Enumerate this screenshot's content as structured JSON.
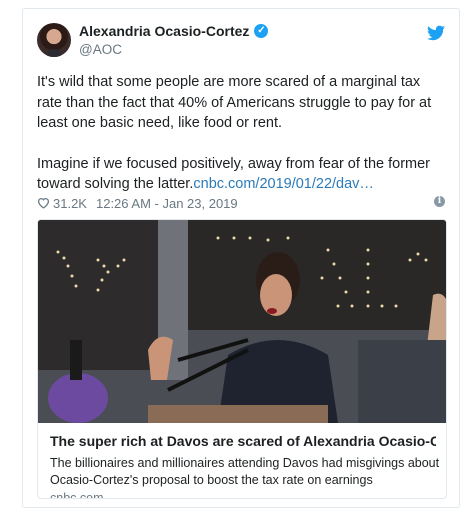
{
  "tweet": {
    "author_name": "Alexandria Ocasio-Cortez",
    "author_handle": "@AOC",
    "verified_mark": "✓",
    "paragraph_1": "It's wild that some people are more scared of a marginal tax rate than the fact that 40% of Americans struggle to pay for at least one basic need, like food or rent.",
    "paragraph_2": "Imagine if we focused positively, away from fear of the former toward solving the latter.",
    "link_text": "cnbc.com/2019/01/22/dav…",
    "likes": "31.2K",
    "timestamp": "12:26 AM - Jan 23, 2019",
    "info_mark": "i"
  },
  "link_card": {
    "title": "The super rich at Davos are scared of Alexandria Ocasio-C…",
    "description": "The billionaires and millionaires attending Davos had misgivings about Ocasio-Cortez's proposal to boost the tax rate on earnings",
    "domain": "cnbc.com"
  },
  "icons": {
    "avatar": "avatar",
    "verified": "verified-badge-icon",
    "bird": "twitter-bird-icon",
    "heart": "heart-icon",
    "info": "info-icon"
  },
  "colors": {
    "link": "#2b7bb9",
    "twitter_blue": "#1da1f2",
    "muted": "#697882",
    "border": "#e1e8ed"
  }
}
